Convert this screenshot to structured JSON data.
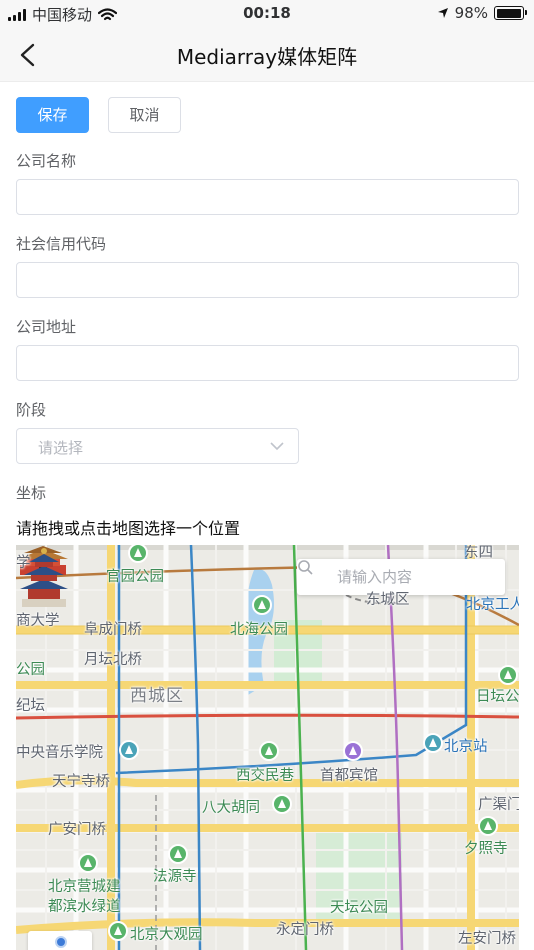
{
  "status_bar": {
    "carrier": "中国移动",
    "time": "00:18",
    "battery": "98%",
    "battery_level": 0.98,
    "icons": [
      "signal-icon",
      "wifi-icon",
      "location-arrow-icon",
      "battery-icon"
    ]
  },
  "nav": {
    "title": "Mediarray媒体矩阵",
    "back_icon": "chevron-left-icon"
  },
  "actions": {
    "save_label": "保存",
    "cancel_label": "取消"
  },
  "form": {
    "company_name_label": "公司名称",
    "company_name_value": "",
    "credit_code_label": "社会信用代码",
    "credit_code_value": "",
    "address_label": "公司地址",
    "address_value": "",
    "stage_label": "阶段",
    "stage_placeholder": "请选择",
    "coordinates_label": "坐标",
    "map_hint": "请拖拽或点击地图选择一个位置"
  },
  "map": {
    "search_placeholder": "请输入内容",
    "labels": {
      "xue": "学",
      "guanyuan_park": "官园公园",
      "dongcheng_district": "东城区",
      "beijing_gongren": "北京工人",
      "dongsi": "东四",
      "nanda_xue": "商大学",
      "fuchengmen_bridge": "阜成门桥",
      "beihai_park": "北海公园",
      "yue_bei_bridge": "月坛北桥",
      "yuan_park": "公园",
      "xicheng_district": "西城区",
      "ritan_park": "日坛公",
      "ji_yuan": "纪坛",
      "central_conservatory": "中央音乐学院",
      "beijing_station": "北京站",
      "xijiao_minxiang": "西交民巷",
      "capital_hotel": "首都宾馆",
      "tianning_temple_bridge": "天宁寺桥",
      "guangqu_gate": "广渠门",
      "badahutong": "八大胡同",
      "guanganmen_bridge": "广安门桥",
      "xizhao_temple": "夕照寺",
      "fayuan_temple": "法源寺",
      "beijing_yingcheng": "北京营城建",
      "dubin_greenway": "都滨水绿道",
      "temple_of_heaven": "天坛公园",
      "beijing_grand_view": "北京大观园",
      "yongdingmen_bridge": "永定门桥",
      "zuoanmen_bridge": "左安门桥"
    },
    "icons": [
      "search-icon",
      "tiananmen-icon",
      "temple-of-heaven-icon",
      "park-icon",
      "railway-station-icon",
      "hotel-icon",
      "locate-icon"
    ]
  },
  "colors": {
    "primary": "#409eff",
    "border": "#dcdfe6",
    "label": "#606266",
    "map_bg": "#ecebe6",
    "park_green": "#58b46a",
    "road_yellow": "#f6d774",
    "metro_red": "#d9503f",
    "metro_blue": "#3b86c6",
    "metro_green": "#4bb24f",
    "metro_purple": "#b06fc2"
  }
}
